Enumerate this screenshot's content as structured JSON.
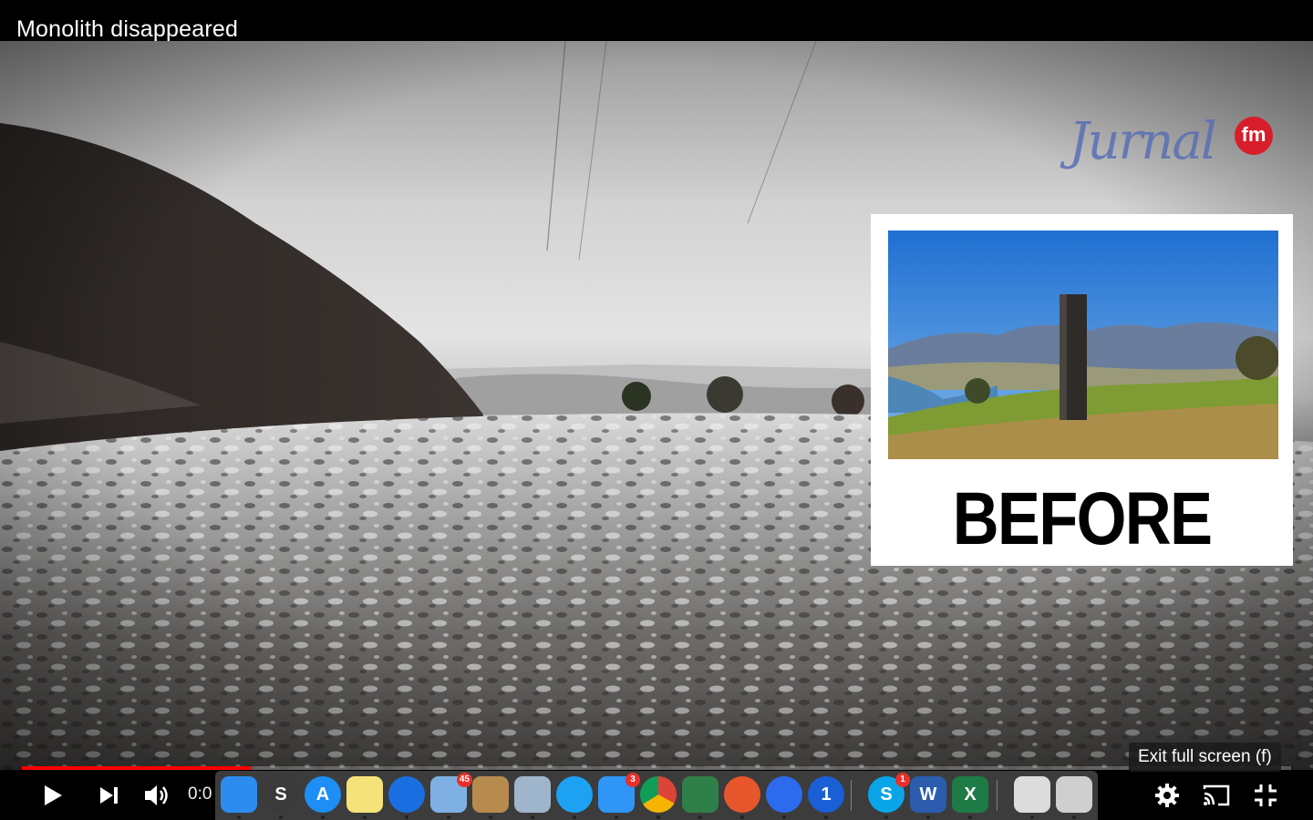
{
  "video": {
    "title": "Monolith disappeared",
    "watermark": {
      "text": "Jurnal",
      "badge": "fm"
    },
    "inset_label": "BEFORE",
    "progress": 0.18
  },
  "controls": {
    "time": "0:0",
    "tooltip": "Exit full screen (f)",
    "icons": [
      "play-icon",
      "next-icon",
      "volume-icon",
      "settings-icon",
      "cast-icon",
      "exit-fullscreen-icon"
    ]
  },
  "dock": {
    "apps": [
      {
        "name": "finder",
        "label": "",
        "badge": "",
        "color": "#2d8cf0"
      },
      {
        "name": "scrivener",
        "label": "S",
        "badge": "",
        "color": "#3a3a3a"
      },
      {
        "name": "app-store",
        "label": "A",
        "badge": "",
        "color": "#1c8ef5"
      },
      {
        "name": "notes",
        "label": "",
        "badge": "",
        "color": "#f6e27a"
      },
      {
        "name": "safari",
        "label": "",
        "badge": "",
        "color": "#1a6fe0"
      },
      {
        "name": "mail",
        "label": "",
        "badge": "45",
        "color": "#7fb0e4"
      },
      {
        "name": "contacts",
        "label": "",
        "badge": "",
        "color": "#b78a4e"
      },
      {
        "name": "preview",
        "label": "",
        "badge": "",
        "color": "#9fb5cb"
      },
      {
        "name": "twitter",
        "label": "",
        "badge": "",
        "color": "#1da1f2"
      },
      {
        "name": "messages",
        "label": "",
        "badge": "3",
        "color": "#2f95f7"
      },
      {
        "name": "chrome",
        "label": "",
        "badge": "",
        "color": "#ffffff"
      },
      {
        "name": "image-capture",
        "label": "",
        "badge": "",
        "color": "#2f7f48"
      },
      {
        "name": "firefox",
        "label": "",
        "badge": "",
        "color": "#e8572b"
      },
      {
        "name": "signal",
        "label": "",
        "badge": "",
        "color": "#2c6bed"
      },
      {
        "name": "1password",
        "label": "1",
        "badge": "",
        "color": "#1a5fd6"
      },
      {
        "name": "skype",
        "label": "S",
        "badge": "1",
        "color": "#0aa5e8"
      },
      {
        "name": "word",
        "label": "W",
        "badge": "",
        "color": "#2b5cad"
      },
      {
        "name": "excel",
        "label": "X",
        "badge": "",
        "color": "#1e7b45"
      },
      {
        "name": "document",
        "label": "",
        "badge": "",
        "color": "#dcdcdc"
      },
      {
        "name": "trash",
        "label": "",
        "badge": "",
        "color": "#cfcfcf"
      }
    ]
  }
}
